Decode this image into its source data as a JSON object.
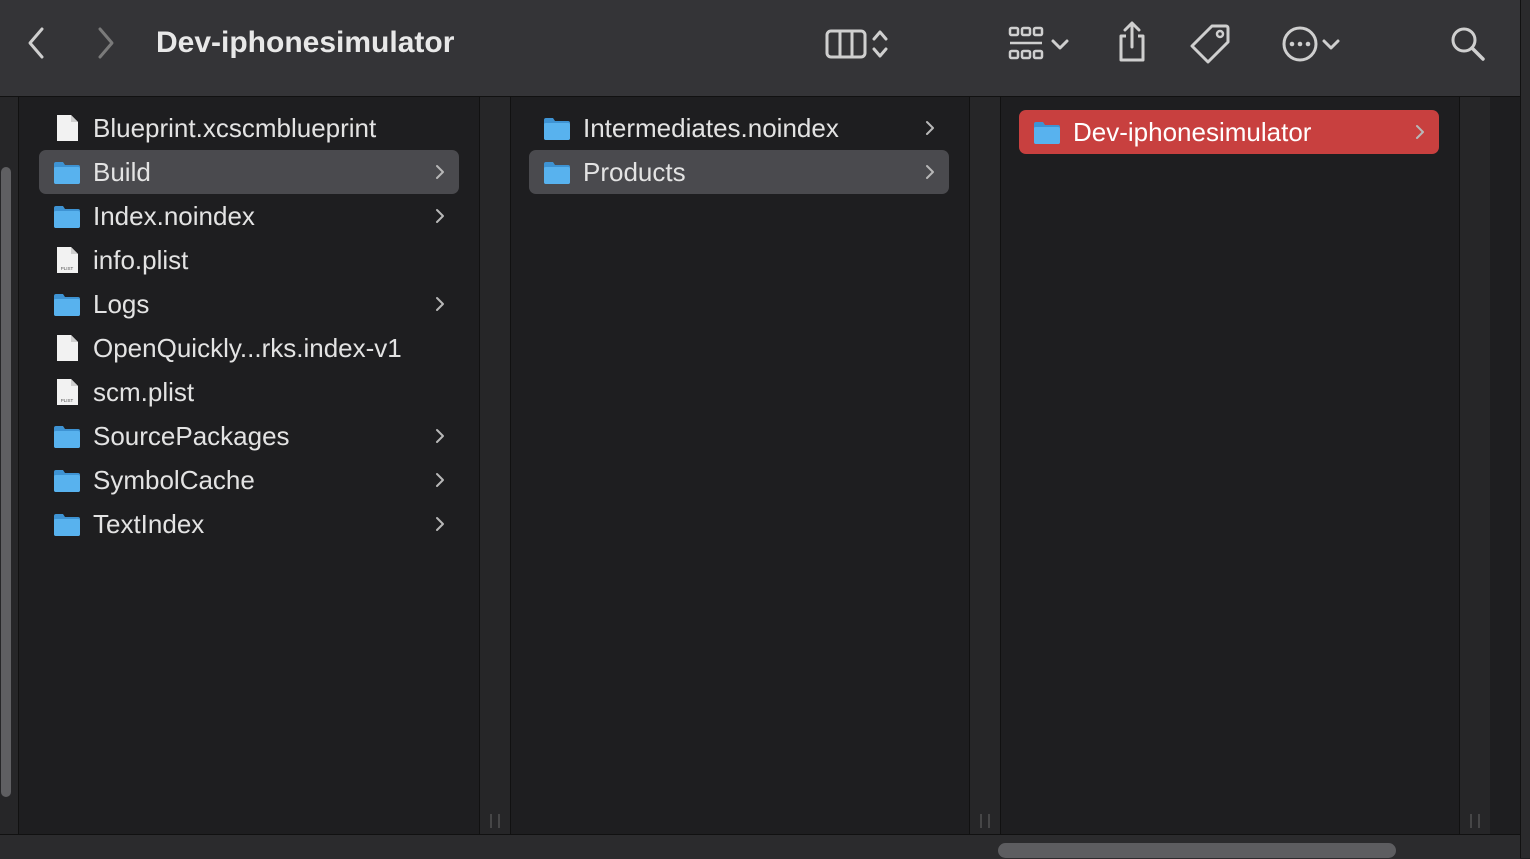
{
  "toolbar": {
    "title": "Dev-iphonesimulator",
    "icons": [
      "chevron-left-icon",
      "chevron-right-icon",
      "columns-view-icon",
      "sort-arrows-icon",
      "grid-group-icon",
      "chevron-down-icon",
      "share-icon",
      "tag-icon",
      "more-circle-icon",
      "search-icon"
    ]
  },
  "columns": [
    {
      "items": [
        {
          "label": "Blueprint.xcscmblueprint",
          "kind": "file",
          "has_children": false,
          "selected": ""
        },
        {
          "label": "Build",
          "kind": "folder",
          "has_children": true,
          "selected": "gray"
        },
        {
          "label": "Index.noindex",
          "kind": "folder",
          "has_children": true,
          "selected": ""
        },
        {
          "label": "info.plist",
          "kind": "plist",
          "has_children": false,
          "selected": ""
        },
        {
          "label": "Logs",
          "kind": "folder",
          "has_children": true,
          "selected": ""
        },
        {
          "label": "OpenQuickly...rks.index-v1",
          "kind": "file",
          "has_children": false,
          "selected": ""
        },
        {
          "label": "scm.plist",
          "kind": "plist",
          "has_children": false,
          "selected": ""
        },
        {
          "label": "SourcePackages",
          "kind": "folder",
          "has_children": true,
          "selected": ""
        },
        {
          "label": "SymbolCache",
          "kind": "folder",
          "has_children": true,
          "selected": ""
        },
        {
          "label": "TextIndex",
          "kind": "folder",
          "has_children": true,
          "selected": ""
        }
      ]
    },
    {
      "items": [
        {
          "label": "Intermediates.noindex",
          "kind": "folder",
          "has_children": true,
          "selected": ""
        },
        {
          "label": "Products",
          "kind": "folder",
          "has_children": true,
          "selected": "gray"
        }
      ]
    },
    {
      "items": [
        {
          "label": "Dev-iphonesimulator",
          "kind": "folder",
          "has_children": true,
          "selected": "red"
        }
      ]
    }
  ],
  "colors": {
    "selection_gray": "#4a4a4e",
    "selection_red": "#c8403f",
    "folder_blue": "#58b2ee"
  },
  "plist_badge": "PLIST"
}
